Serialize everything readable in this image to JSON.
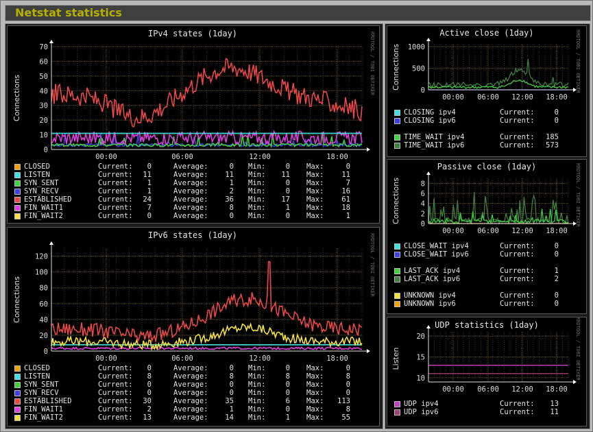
{
  "page_title": "Netstat statistics",
  "watermark": "RRDTOOL / TOBI OETIKER",
  "legend_labels": {
    "current": "Current:",
    "average": "Average:",
    "min": "Min:",
    "max": "Max:"
  },
  "graphs": [
    {
      "id": "ipv4_states",
      "title": "IPv4 states  (1day)",
      "ylabel": "Connections",
      "x_ticks": [
        "00:00",
        "06:00",
        "12:00",
        "18:00"
      ],
      "y_ticks": [
        "0",
        "10",
        "20",
        "30",
        "40",
        "50",
        "60",
        "70"
      ],
      "legend": [
        {
          "label": "CLOSED",
          "color": "#f0a000",
          "current": "0",
          "average": "0",
          "min": "0",
          "max": "0"
        },
        {
          "label": "LISTEN",
          "color": "#40e0e0",
          "current": "11",
          "average": "11",
          "min": "11",
          "max": "11"
        },
        {
          "label": "SYN_SENT",
          "color": "#40d040",
          "current": "1",
          "average": "1",
          "min": "0",
          "max": "7"
        },
        {
          "label": "SYN_RECV",
          "color": "#4040e0",
          "current": "1",
          "average": "2",
          "min": "0",
          "max": "16"
        },
        {
          "label": "ESTABLISHED",
          "color": "#e84848",
          "current": "24",
          "average": "36",
          "min": "17",
          "max": "61"
        },
        {
          "label": "FIN_WAIT1",
          "color": "#e040e0",
          "current": "7",
          "average": "8",
          "min": "1",
          "max": "18"
        },
        {
          "label": "FIN_WAIT2",
          "color": "#f0e040",
          "current": "0",
          "average": "0",
          "min": "0",
          "max": "1"
        }
      ]
    },
    {
      "id": "ipv6_states",
      "title": "IPv6 states  (1day)",
      "ylabel": "Connections",
      "x_ticks": [
        "00:00",
        "06:00",
        "12:00",
        "18:00"
      ],
      "y_ticks": [
        "0",
        "20",
        "40",
        "60",
        "80",
        "100",
        "120"
      ],
      "legend": [
        {
          "label": "CLOSED",
          "color": "#f0a000",
          "current": "0",
          "average": "0",
          "min": "0",
          "max": "0"
        },
        {
          "label": "LISTEN",
          "color": "#40e0e0",
          "current": "8",
          "average": "8",
          "min": "8",
          "max": "8"
        },
        {
          "label": "SYN_SENT",
          "color": "#40d040",
          "current": "0",
          "average": "0",
          "min": "0",
          "max": "0"
        },
        {
          "label": "SYN_RECV",
          "color": "#4040e0",
          "current": "0",
          "average": "0",
          "min": "0",
          "max": "0"
        },
        {
          "label": "ESTABLISHED",
          "color": "#e84848",
          "current": "30",
          "average": "35",
          "min": "6",
          "max": "113"
        },
        {
          "label": "FIN_WAIT1",
          "color": "#e040e0",
          "current": "2",
          "average": "1",
          "min": "0",
          "max": "8"
        },
        {
          "label": "FIN_WAIT2",
          "color": "#f0e040",
          "current": "13",
          "average": "14",
          "min": "1",
          "max": "55"
        }
      ]
    },
    {
      "id": "active_close",
      "title": "Active close  (1day)",
      "ylabel": "Connections",
      "x_ticks": [
        "00:00",
        "06:00",
        "12:00",
        "18:00"
      ],
      "y_ticks": [
        "0",
        "500",
        "1000"
      ],
      "legend": [
        {
          "label": "CLOSING ipv4",
          "color": "#40e0e0",
          "current": "0"
        },
        {
          "label": "CLOSING ipv6",
          "color": "#4040e0",
          "current": "0"
        },
        {
          "label": "TIME_WAIT ipv4",
          "color": "#40d040",
          "current": "185"
        },
        {
          "label": "TIME_WAIT ipv6",
          "color": "#408040",
          "current": "573"
        }
      ]
    },
    {
      "id": "passive_close",
      "title": "Passive close  (1day)",
      "ylabel": "Connections",
      "x_ticks": [
        "00:00",
        "06:00",
        "12:00",
        "18:00"
      ],
      "y_ticks": [
        "0",
        "2",
        "4",
        "6",
        "8"
      ],
      "legend": [
        {
          "label": "CLOSE_WAIT ipv4",
          "color": "#40e0e0",
          "current": "0"
        },
        {
          "label": "CLOSE_WAIT ipv6",
          "color": "#4040e0",
          "current": "0"
        },
        {
          "label": "LAST_ACK ipv4",
          "color": "#40d040",
          "current": "1"
        },
        {
          "label": "LAST_ACK ipv6",
          "color": "#408040",
          "current": "2"
        },
        {
          "label": "UNKNOWN ipv4",
          "color": "#f0e040",
          "current": "0"
        },
        {
          "label": "UNKNOWN ipv6",
          "color": "#f0a000",
          "current": "0"
        }
      ]
    },
    {
      "id": "udp_statistics",
      "title": "UDP statistics  (1day)",
      "ylabel": "Listen",
      "x_ticks": [
        "00:00",
        "06:00",
        "12:00",
        "18:00"
      ],
      "y_ticks": [
        "10",
        "15",
        "20"
      ],
      "legend": [
        {
          "label": "UDP ipv4",
          "color": "#c040c0",
          "current": "13"
        },
        {
          "label": "UDP ipv6",
          "color": "#a04070",
          "current": "11"
        }
      ]
    }
  ]
}
